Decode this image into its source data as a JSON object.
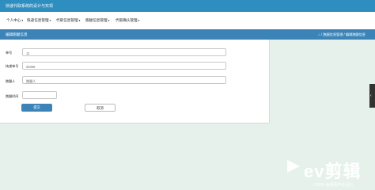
{
  "header": {
    "title": "快递代取系统的设计与实现"
  },
  "nav": [
    {
      "label": "个人中心"
    },
    {
      "label": "快递信息管理"
    },
    {
      "label": "代取信息管理"
    },
    {
      "label": "跑腿信息管理"
    },
    {
      "label": "代取确认管理"
    }
  ],
  "banner": {
    "title": "编辑跑腿信息",
    "breadcrumb": "⌂ / 跑腿信息管理 / 编辑跑腿信息"
  },
  "form": {
    "fields": [
      {
        "label": "单号",
        "value": "11"
      },
      {
        "label": "快递单号",
        "value": "23456"
      },
      {
        "label": "跑腿人",
        "placeholder": "跑腿人"
      },
      {
        "label": "跑腿时间",
        "value": ""
      }
    ],
    "submit_label": "提交",
    "cancel_label": "取消"
  },
  "watermark": {
    "brand": "ev剪辑",
    "credit": "CSDN @源码毕业设计"
  }
}
